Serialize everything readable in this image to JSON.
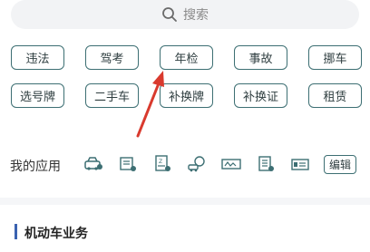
{
  "search": {
    "placeholder": "搜索"
  },
  "services": {
    "row1": [
      "违法",
      "驾考",
      "年检",
      "事故",
      "挪车"
    ],
    "row2": [
      "选号牌",
      "二手车",
      "补换牌",
      "补换证",
      "租赁"
    ]
  },
  "my_apps": {
    "label": "我的应用",
    "icons": [
      "car-service-icon",
      "license-scroll-icon",
      "document-icon",
      "vehicle-check-icon",
      "plate-card-icon",
      "checklist-icon",
      "id-card-icon"
    ],
    "edit_label": "编辑"
  },
  "section": {
    "title": "机动车业务"
  },
  "colors": {
    "tag_border": "#3d6f73",
    "arrow": "#d93a2e",
    "section_accent": "#3a62b0"
  }
}
